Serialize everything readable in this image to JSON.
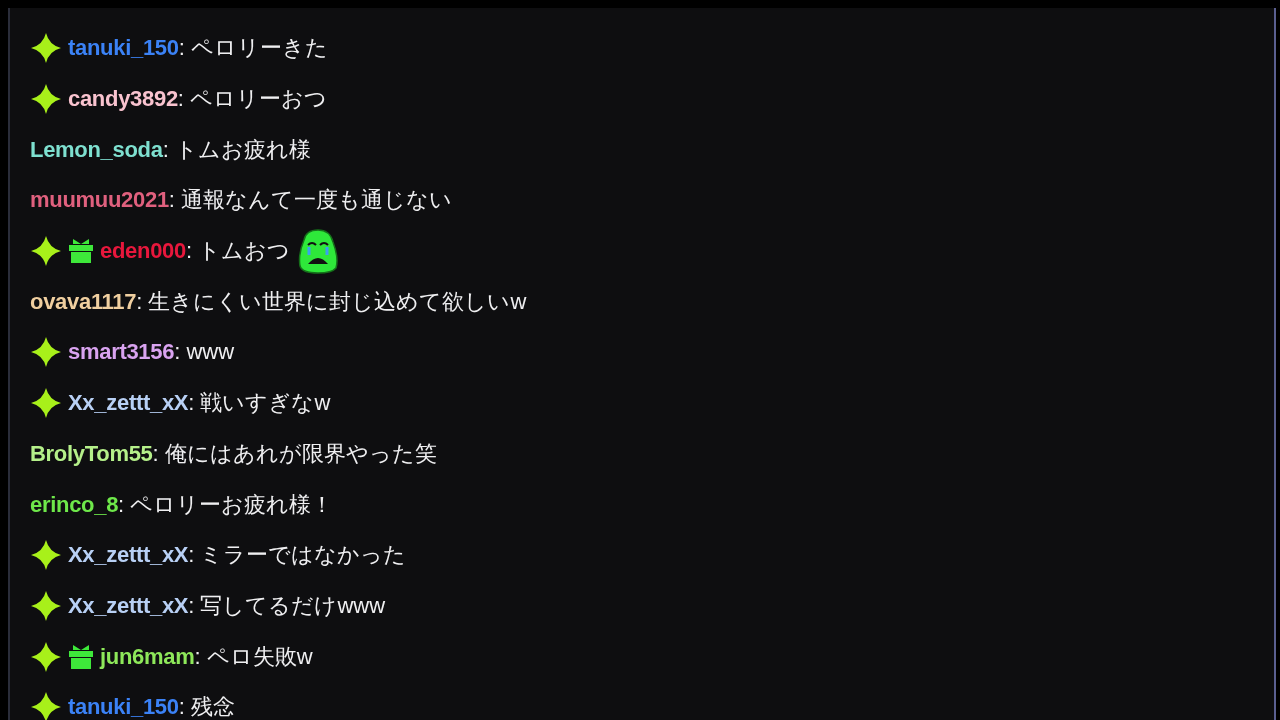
{
  "messages": [
    {
      "badges": [
        {
          "kind": "sparkle"
        }
      ],
      "user": "tanuki_150",
      "color": "#3b82f6",
      "text": ": ペロリーきた"
    },
    {
      "badges": [
        {
          "kind": "sparkle"
        }
      ],
      "user": "candy3892",
      "color": "#f9c3cf",
      "text": ": ペロリーおつ"
    },
    {
      "user": "Lemon_soda",
      "color": "#7ee0d0",
      "text": ": トムお疲れ様"
    },
    {
      "user": "muumuu2021",
      "color": "#e0607e",
      "text": ": 通報なんて一度も通じない"
    },
    {
      "badges": [
        {
          "kind": "sparkle"
        },
        {
          "kind": "gift"
        }
      ],
      "user": "eden000",
      "color": "#e8173c",
      "text": ": トムおつ",
      "emote": {
        "kind": "crying"
      }
    },
    {
      "user": "ovava1117",
      "color": "#f0cfa0",
      "text": ": 生きにくい世界に封じ込めて欲しいw"
    },
    {
      "badges": [
        {
          "kind": "sparkle"
        }
      ],
      "user": "smart3156",
      "color": "#d9a3f0",
      "text": ": www"
    },
    {
      "badges": [
        {
          "kind": "sparkle"
        }
      ],
      "user": "Xx_zettt_xX",
      "color": "#b8d0f5",
      "text": ": 戦いすぎなw"
    },
    {
      "user": "BrolyTom55",
      "color": "#b5f08a",
      "text": ": 俺にはあれが限界やった笑"
    },
    {
      "user": "erinco_8",
      "color": "#6ee84a",
      "text": ": ペロリーお疲れ様！"
    },
    {
      "badges": [
        {
          "kind": "sparkle"
        }
      ],
      "user": "Xx_zettt_xX",
      "color": "#b8d0f5",
      "text": ": ミラーではなかった"
    },
    {
      "badges": [
        {
          "kind": "sparkle"
        }
      ],
      "user": "Xx_zettt_xX",
      "color": "#b8d0f5",
      "text": ": 写してるだけwww"
    },
    {
      "badges": [
        {
          "kind": "sparkle"
        },
        {
          "kind": "gift"
        }
      ],
      "user": "jun6mam",
      "color": "#8ee85a",
      "text": ": ペロ失敗w"
    },
    {
      "badges": [
        {
          "kind": "sparkle"
        }
      ],
      "user": "tanuki_150",
      "color": "#3b82f6",
      "text": ": 残念"
    }
  ]
}
